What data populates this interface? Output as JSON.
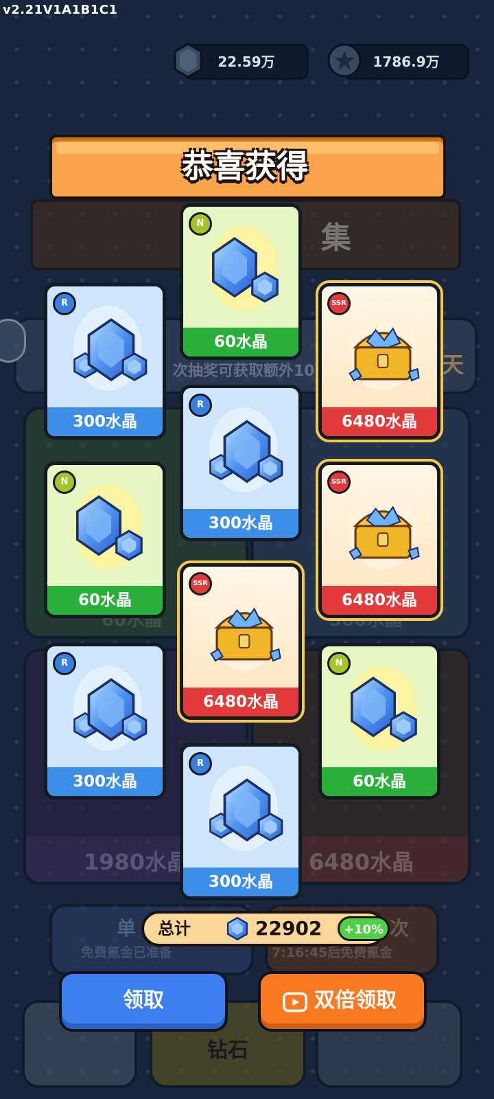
{
  "version": "v2.21V1A1B1C1",
  "currencies": {
    "crystal": {
      "icon": "crystal-icon",
      "value": "22.59万"
    },
    "coin": {
      "icon": "star-coin-icon",
      "value": "1786.9万"
    }
  },
  "title": "恭喜获得",
  "background": {
    "banner_partial": "集",
    "info_partial": "次抽奖可获取额外10",
    "side_partial": "天",
    "card_left_label": "60水晶",
    "card_right_label": "300水晶",
    "pack_left_label": "1980水晶",
    "pack_right_label": "6480水晶",
    "single_draw": {
      "label": "单",
      "sub": "免费氪金已准备"
    },
    "multi_draw": {
      "label": "次",
      "sub": "7:16:45后免费氪金"
    },
    "bottom_mid": "钻石"
  },
  "cards": [
    {
      "rarity": "N",
      "label": "60水晶",
      "art": "crystal-small"
    },
    {
      "rarity": "R",
      "label": "300水晶",
      "art": "crystal-medium"
    },
    {
      "rarity": "SSR",
      "label": "6480水晶",
      "art": "treasure-chest"
    },
    {
      "rarity": "R",
      "label": "300水晶",
      "art": "crystal-medium"
    },
    {
      "rarity": "N",
      "label": "60水晶",
      "art": "crystal-small"
    },
    {
      "rarity": "SSR",
      "label": "6480水晶",
      "art": "treasure-chest"
    },
    {
      "rarity": "SSR",
      "label": "6480水晶",
      "art": "treasure-chest"
    },
    {
      "rarity": "R",
      "label": "300水晶",
      "art": "crystal-medium"
    },
    {
      "rarity": "N",
      "label": "60水晶",
      "art": "crystal-small"
    },
    {
      "rarity": "R",
      "label": "300水晶",
      "art": "crystal-medium"
    }
  ],
  "total": {
    "label": "总计",
    "value": "22902",
    "bonus": "+10%"
  },
  "buttons": {
    "claim": "领取",
    "double_claim": "双倍领取"
  },
  "colors": {
    "N": "#29b03b",
    "R": "#3c8ee8",
    "SSR": "#e2393b",
    "orange": "#fb7a21",
    "blue": "#3b7ff0"
  }
}
